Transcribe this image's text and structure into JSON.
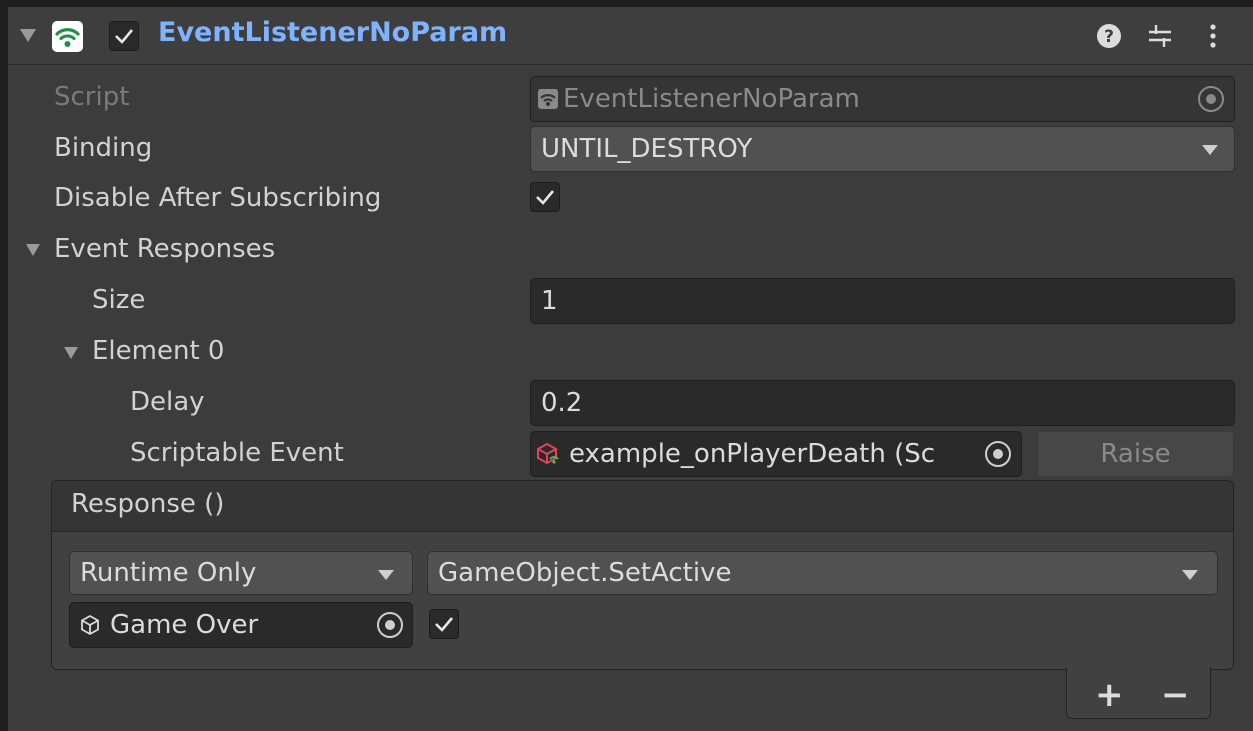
{
  "component": {
    "title": "EventListenerNoParam",
    "enabled": true,
    "icon": "broadcast-icon",
    "header_buttons": [
      "help-icon",
      "preset-icon",
      "kebab-menu-icon"
    ]
  },
  "fields": {
    "script": {
      "label": "Script",
      "value": "EventListenerNoParam"
    },
    "binding": {
      "label": "Binding",
      "value": "UNTIL_DESTROY"
    },
    "disable_after": {
      "label": "Disable After Subscribing",
      "checked": true
    }
  },
  "event_responses": {
    "label": "Event Responses",
    "size_label": "Size",
    "size_value": "1",
    "element": {
      "label": "Element 0",
      "delay_label": "Delay",
      "delay_value": "0.2",
      "event_label": "Scriptable Event",
      "event_value": "example_onPlayerDeath (Sc",
      "raise_label": "Raise"
    }
  },
  "response": {
    "header": "Response ()",
    "mode": "Runtime Only",
    "function": "GameObject.SetActive",
    "target": "Game Over",
    "arg_checked": true,
    "add_label": "+",
    "remove_label": "−"
  },
  "colors": {
    "title": "#7fb3ff",
    "background": "#3c3c3c",
    "field": "#2a2a2a",
    "dropdown": "#515151"
  }
}
